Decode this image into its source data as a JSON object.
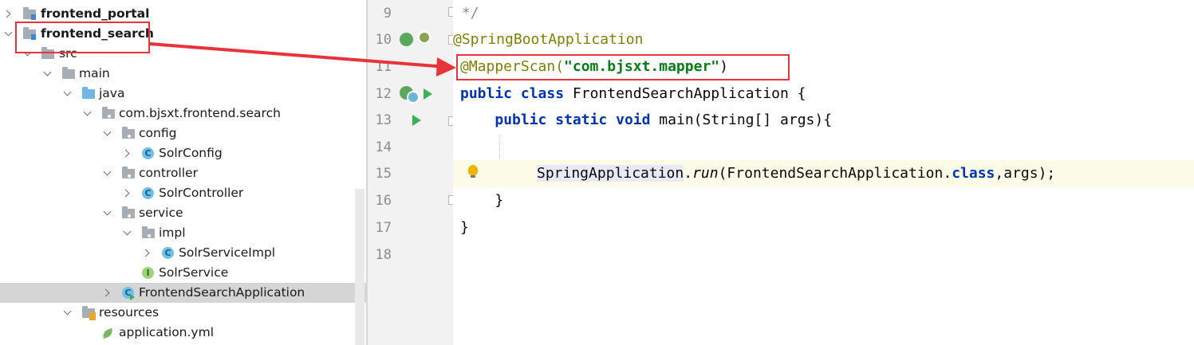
{
  "tree": {
    "items": [
      {
        "label": "frontend_portal",
        "bold": true
      },
      {
        "label": "frontend_search",
        "bold": true
      },
      {
        "label": "src"
      },
      {
        "label": "main"
      },
      {
        "label": "java"
      },
      {
        "label": "com.bjsxt.frontend.search"
      },
      {
        "label": "config"
      },
      {
        "label": "SolrConfig"
      },
      {
        "label": "controller"
      },
      {
        "label": "SolrController"
      },
      {
        "label": "service"
      },
      {
        "label": "impl"
      },
      {
        "label": "SolrServiceImpl"
      },
      {
        "label": "SolrService"
      },
      {
        "label": "FrontendSearchApplication"
      },
      {
        "label": "resources"
      },
      {
        "label": "application.yml"
      }
    ]
  },
  "editor": {
    "line_numbers": [
      "9",
      "10",
      "11",
      "12",
      "13",
      "14",
      "15",
      "16",
      "17",
      "18"
    ],
    "code": {
      "l9_comment": " */",
      "l10_annotation": "@SpringBootApplication",
      "l11_annotation": "@MapperScan(",
      "l11_string": "\"com.bjsxt.mapper\"",
      "l11_close": ")",
      "l12_kw1": "public",
      "l12_kw2": "class",
      "l12_rest": " FrontendSearchApplication {",
      "l13_kw1": "public",
      "l13_kw2": "static",
      "l13_kw3": "void",
      "l13_rest": " main(String[] args){",
      "l15_ref": "SpringApplication",
      "l15_dot": ".",
      "l15_method": "run",
      "l15_args": "(FrontendSearchApplication.",
      "l15_kw": "class",
      "l15_end": ",args);",
      "l16_brace": "}",
      "l17_brace": "}"
    }
  },
  "colors": {
    "annotation_highlight": "#e8333a",
    "annotation_color": "#808000",
    "string_color": "#067d17",
    "keyword_color": "#0033b3"
  }
}
